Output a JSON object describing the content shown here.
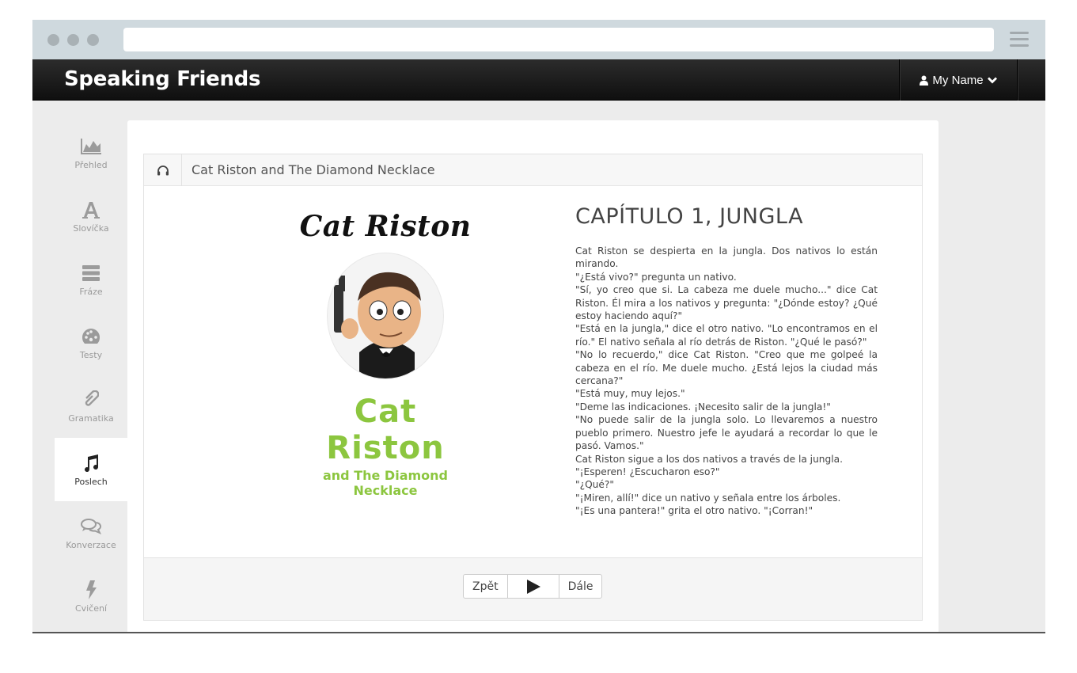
{
  "app": {
    "brand": "Speaking Friends"
  },
  "header": {
    "user_label": "My Name"
  },
  "sidebar": {
    "items": [
      {
        "label": "Přehled",
        "icon": "chart-area-icon"
      },
      {
        "label": "Slovíčka",
        "icon": "font-icon"
      },
      {
        "label": "Fráze",
        "icon": "list-icon"
      },
      {
        "label": "Testy",
        "icon": "dashboard-icon"
      },
      {
        "label": "Gramatika",
        "icon": "paperclip-icon"
      },
      {
        "label": "Poslech",
        "icon": "music-icon",
        "active": true
      },
      {
        "label": "Konverzace",
        "icon": "comments-icon"
      },
      {
        "label": "Cvičení",
        "icon": "bolt-icon"
      }
    ]
  },
  "panel": {
    "title": "Cat Riston and The Diamond Necklace",
    "icon": "headphones-icon"
  },
  "cover": {
    "title": "Cat Riston",
    "subtitle_main": "Cat Riston",
    "subtitle_small": "and The Diamond Necklace"
  },
  "chapter": {
    "title": "CAPÍTULO 1, JUNGLA",
    "paragraphs": [
      "Cat Riston se despierta en la jungla. Dos nativos lo están mirando.",
      "\"¿Está vivo?\" pregunta un nativo.",
      "\"Sí, yo creo que si. La cabeza me duele mucho...\" dice Cat Riston. Él mira a los nativos y pregunta: \"¿Dónde estoy? ¿Qué estoy haciendo aquí?\"",
      "\"Está en la jungla,\" dice el otro nativo. \"Lo encontramos en el río.\" El nativo señala al río detrás de Riston. \"¿Qué le pasó?\"",
      "\"No lo recuerdo,\" dice Cat Riston. \"Creo que me golpeé la cabeza en el río. Me duele mucho. ¿Está lejos la ciudad más cercana?\"",
      "\"Está muy, muy lejos.\"",
      "\"Deme las indicaciones. ¡Necesito salir de la jungla!\"",
      "\"No puede salir de la jungla solo. Lo llevaremos a nuestro pueblo primero. Nuestro jefe le ayudará a recordar lo que le pasó. Vamos.\"",
      "Cat Riston sigue a los dos nativos a través de la jungla.",
      "\"¡Esperen! ¿Escucharon eso?\"",
      "\"¿Qué?\"",
      "\"¡Miren, allí!\" dice un nativo y señala entre los árboles.",
      "\"¡Es una pantera!\" grita el otro nativo. \"¡Corran!\""
    ]
  },
  "player": {
    "prev_label": "Zpět",
    "next_label": "Dále",
    "play_icon": "play-icon"
  },
  "colors": {
    "accent_green": "#8cc63f",
    "navbar": "#111111"
  }
}
